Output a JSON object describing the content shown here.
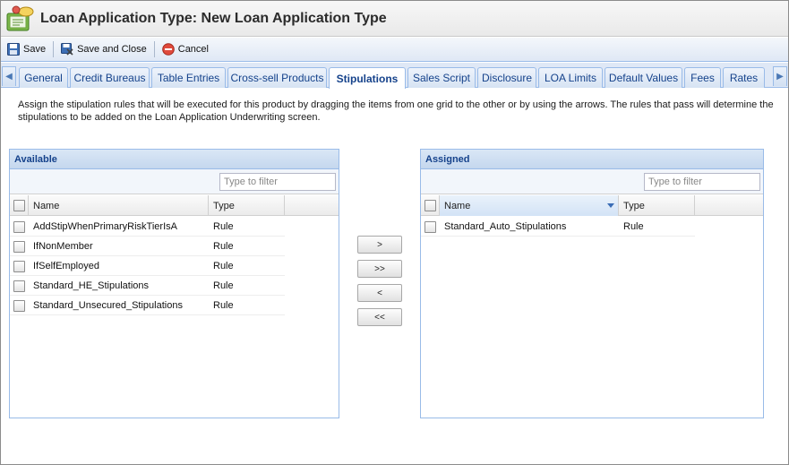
{
  "window": {
    "title": "Loan Application Type: New Loan Application Type"
  },
  "toolbar": {
    "save_label": "Save",
    "save_close_label": "Save and Close",
    "cancel_label": "Cancel"
  },
  "tabs": [
    {
      "label": "General"
    },
    {
      "label": "Credit Bureaus"
    },
    {
      "label": "Table Entries"
    },
    {
      "label": "Cross-sell Products"
    },
    {
      "label": "Stipulations",
      "active": true
    },
    {
      "label": "Sales Script"
    },
    {
      "label": "Disclosure"
    },
    {
      "label": "LOA Limits"
    },
    {
      "label": "Default Values"
    },
    {
      "label": "Fees"
    },
    {
      "label": "Rates"
    }
  ],
  "description": "Assign the stipulation rules that will be executed for this product by dragging the items from one grid to the other or by using the arrows. The rules that pass will determine the stipulations to be added on the Loan Application Underwriting screen.",
  "available": {
    "title": "Available",
    "filter_placeholder": "Type to filter",
    "columns": {
      "name": "Name",
      "type": "Type"
    },
    "rows": [
      {
        "name": "AddStipWhenPrimaryRiskTierIsA",
        "type": "Rule"
      },
      {
        "name": "IfNonMember",
        "type": "Rule"
      },
      {
        "name": "IfSelfEmployed",
        "type": "Rule"
      },
      {
        "name": "Standard_HE_Stipulations",
        "type": "Rule"
      },
      {
        "name": "Standard_Unsecured_Stipulations",
        "type": "Rule"
      }
    ]
  },
  "assigned": {
    "title": "Assigned",
    "filter_placeholder": "Type to filter",
    "columns": {
      "name": "Name",
      "type": "Type"
    },
    "rows": [
      {
        "name": "Standard_Auto_Stipulations",
        "type": "Rule"
      }
    ]
  },
  "move_buttons": {
    "move_right": ">",
    "move_all_right": ">>",
    "move_left": "<",
    "move_all_left": "<<"
  },
  "colors": {
    "accent": "#15428b",
    "border": "#99bbe8",
    "header_bg": "#c5d7ee"
  }
}
